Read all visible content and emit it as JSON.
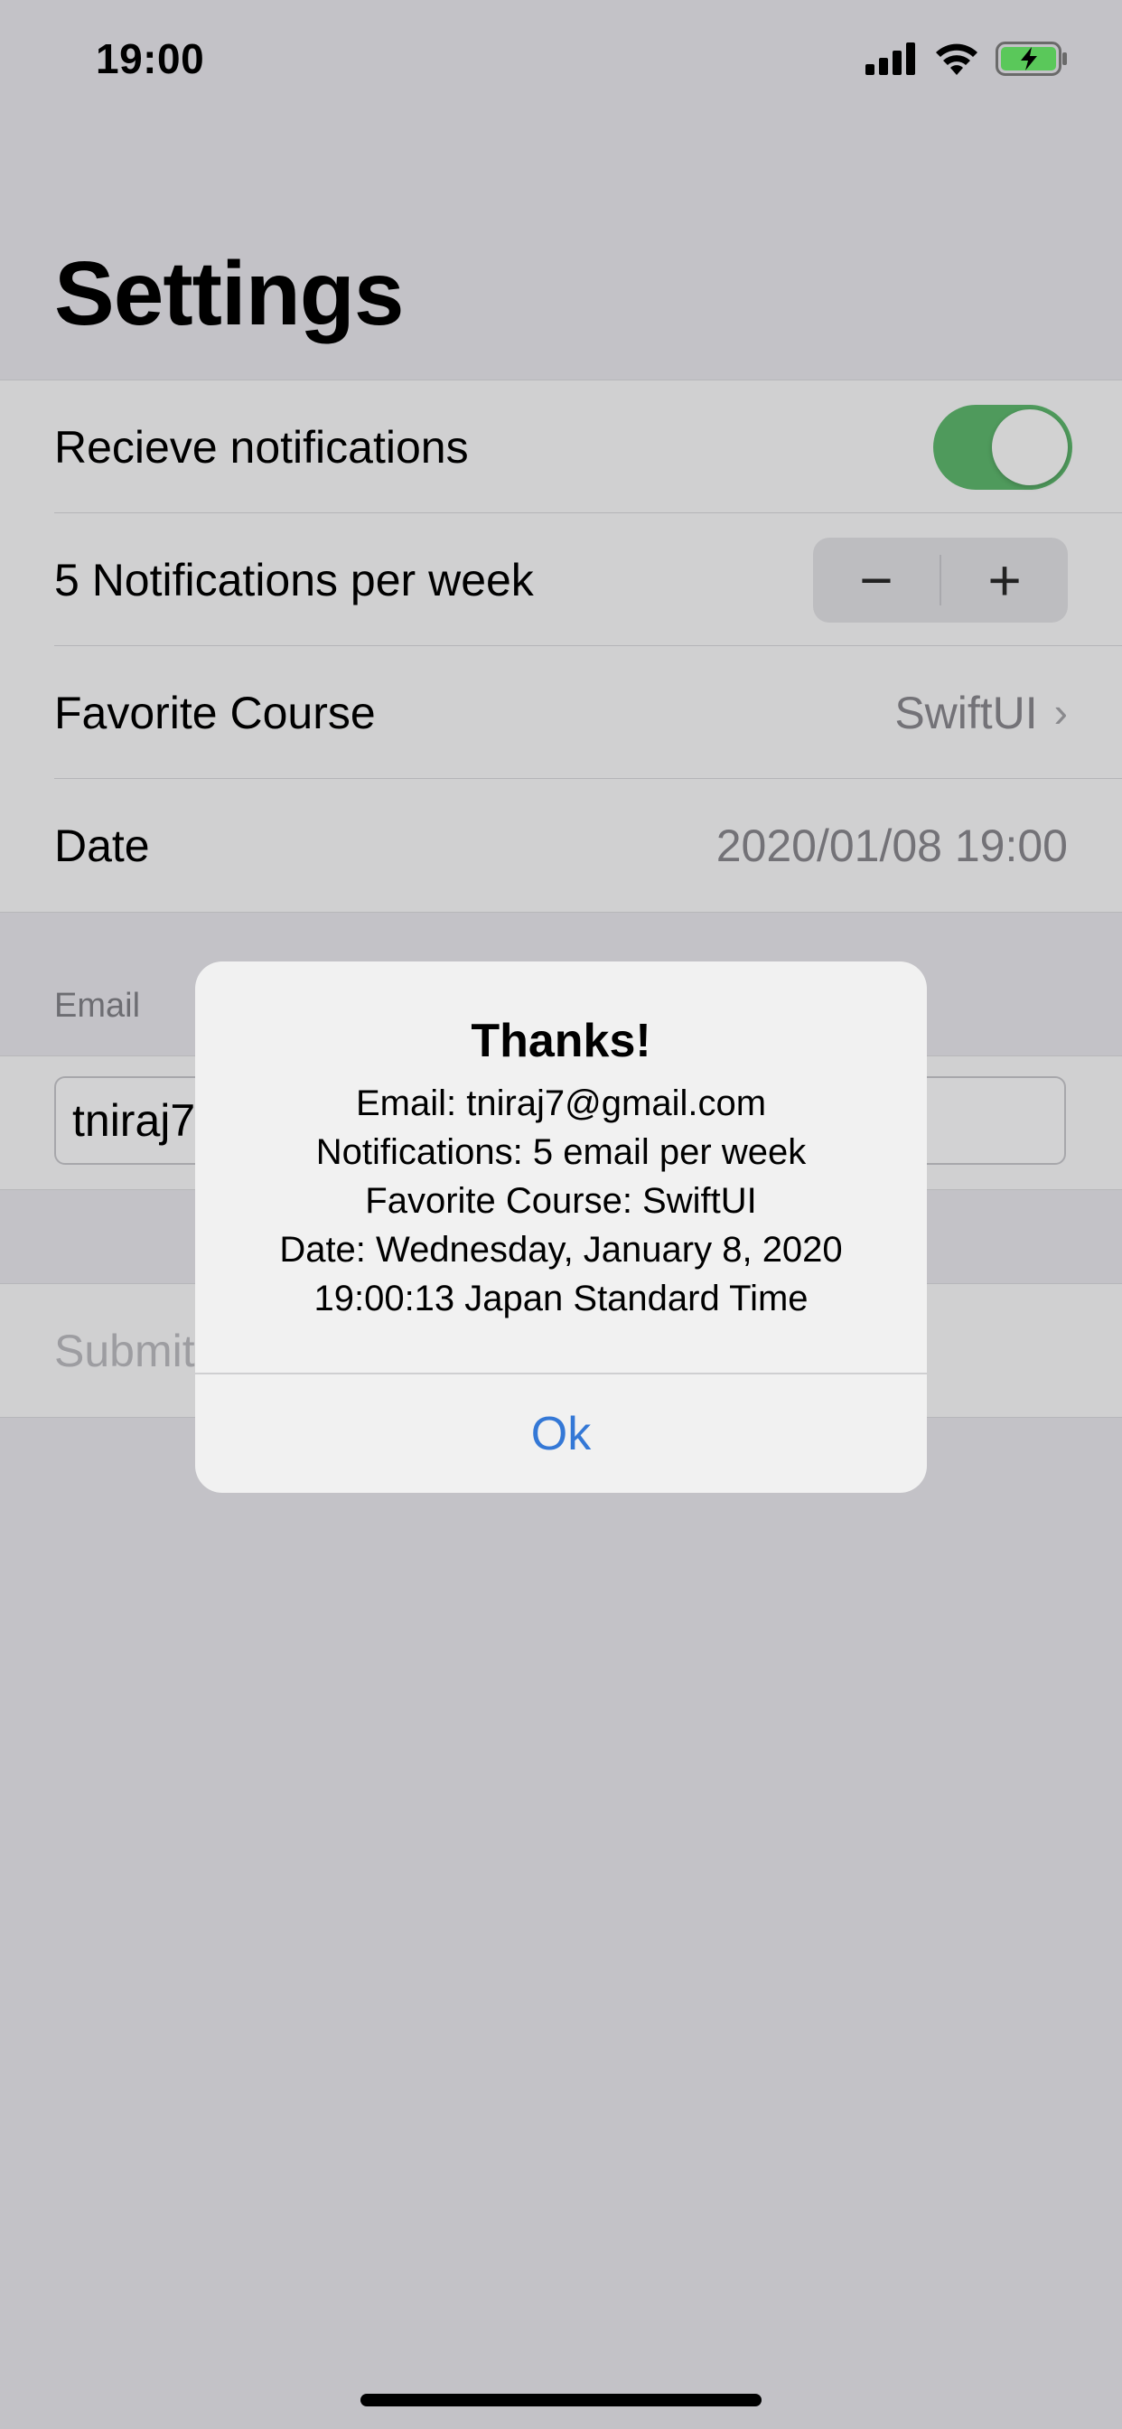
{
  "status_bar": {
    "time": "19:00",
    "icons": [
      "cellular-signal-icon",
      "wifi-icon",
      "battery-charging-icon"
    ],
    "battery_color": "#5ac85a"
  },
  "page": {
    "title": "Settings"
  },
  "settings": {
    "notifications": {
      "label": "Recieve notifications",
      "on": true
    },
    "frequency": {
      "label": "5 Notifications per week",
      "minus": "−",
      "plus": "+"
    },
    "course": {
      "label": "Favorite Course",
      "value": "SwiftUI",
      "chevron": "›"
    },
    "date": {
      "label": "Date",
      "value": "2020/01/08 19:00"
    }
  },
  "email_section": {
    "header": "Email",
    "value": "tniraj7"
  },
  "submit": {
    "label": "Submit"
  },
  "alert": {
    "title": "Thanks!",
    "lines": [
      "Email: tniraj7@gmail.com",
      "Notifications: 5 email per week",
      "Favorite Course: SwiftUI",
      "Date: Wednesday, January 8, 2020",
      "19:00:13 Japan Standard Time"
    ],
    "ok_label": "Ok"
  },
  "colors": {
    "toggle_on": "#4f9a5c",
    "alert_button": "#3478d6",
    "dimmed_background": "#c3c2c7"
  }
}
